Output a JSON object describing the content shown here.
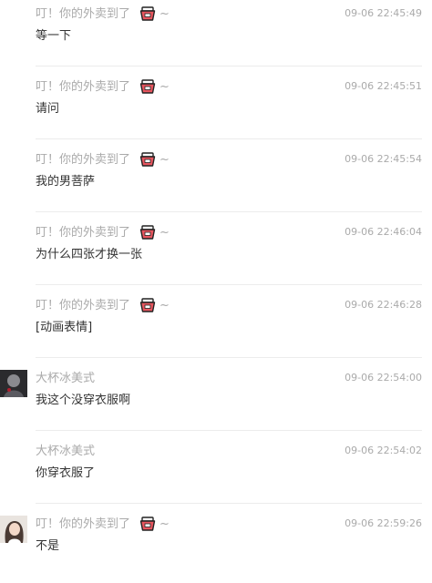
{
  "messages": [
    {
      "user": "叮！你的外卖到了",
      "bowl": true,
      "tilde": "~",
      "time": "09-06 22:45:49",
      "text": "等一下",
      "avatar": ""
    },
    {
      "user": "叮！你的外卖到了",
      "bowl": true,
      "tilde": "~",
      "time": "09-06 22:45:51",
      "text": "请问",
      "avatar": ""
    },
    {
      "user": "叮！你的外卖到了",
      "bowl": true,
      "tilde": "~",
      "time": "09-06 22:45:54",
      "text": "我的男菩萨",
      "avatar": ""
    },
    {
      "user": "叮！你的外卖到了",
      "bowl": true,
      "tilde": "~",
      "time": "09-06 22:46:04",
      "text": "为什么四张才换一张",
      "avatar": ""
    },
    {
      "user": "叮！你的外卖到了",
      "bowl": true,
      "tilde": "~",
      "time": "09-06 22:46:28",
      "text": "[动画表情]",
      "avatar": ""
    },
    {
      "user": "大杯冰美式",
      "bowl": false,
      "tilde": "",
      "time": "09-06 22:54:00",
      "text": "我这个没穿衣服啊",
      "avatar": "dark-portrait"
    },
    {
      "user": "大杯冰美式",
      "bowl": false,
      "tilde": "",
      "time": "09-06 22:54:02",
      "text": "你穿衣服了",
      "avatar": ""
    },
    {
      "user": "叮！你的外卖到了",
      "bowl": true,
      "tilde": "~",
      "time": "09-06 22:59:26",
      "text": "不是",
      "avatar": "light-portrait"
    }
  ],
  "colors": {
    "meta_text": "#aaaaaa",
    "body_text": "#333333",
    "divider": "#ececec"
  },
  "icons": {
    "bowl": "takeout-bowl-icon"
  }
}
